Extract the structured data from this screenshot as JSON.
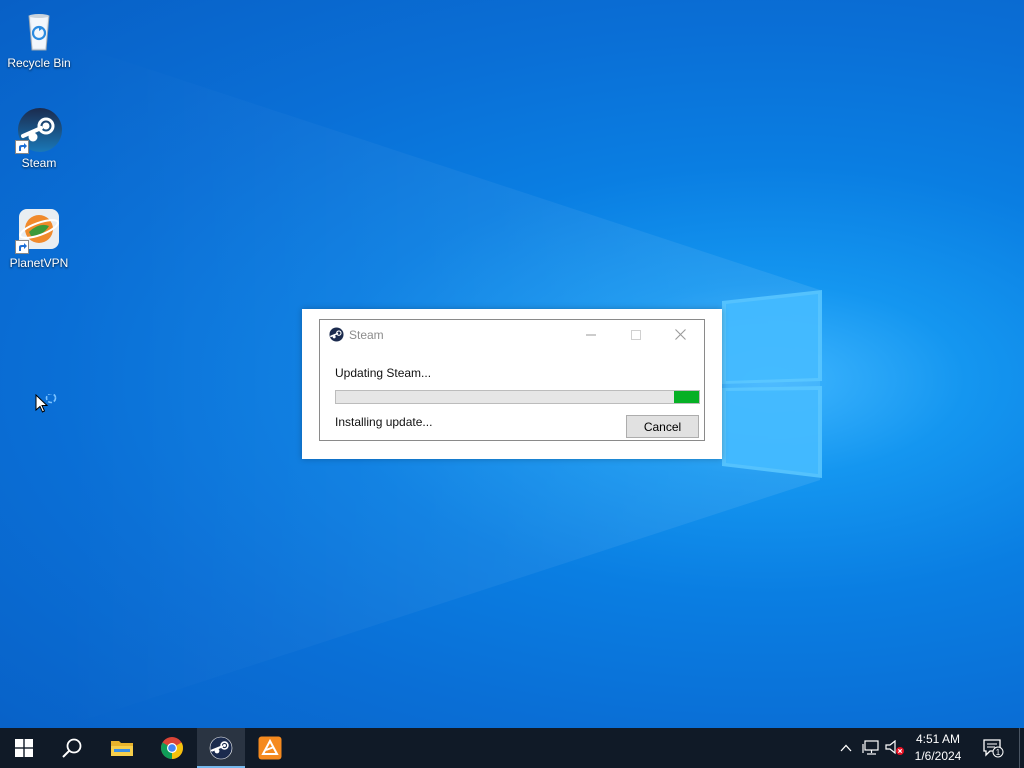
{
  "desktop": {
    "icons": [
      {
        "label": "Recycle Bin",
        "icon": "recycle-bin-icon"
      },
      {
        "label": "Steam",
        "icon": "steam-icon"
      },
      {
        "label": "PlanetVPN",
        "icon": "planetvpn-icon"
      }
    ]
  },
  "dialog": {
    "title": "Steam",
    "status_top": "Updating Steam...",
    "status_bottom": "Installing update...",
    "progress": 0.07,
    "cancel_label": "Cancel"
  },
  "taskbar": {
    "items": [
      "start-icon",
      "search-icon",
      "file-explorer-icon",
      "chrome-icon",
      "steam-icon",
      "app-icon"
    ],
    "active_item": "steam-icon",
    "time": "4:51 AM",
    "date": "1/6/2024",
    "notification_count": "1"
  },
  "colors": {
    "progress_fill": "#06b025",
    "taskbar_bg": "#101a27",
    "desktop_blue": "#0a7ee2"
  }
}
